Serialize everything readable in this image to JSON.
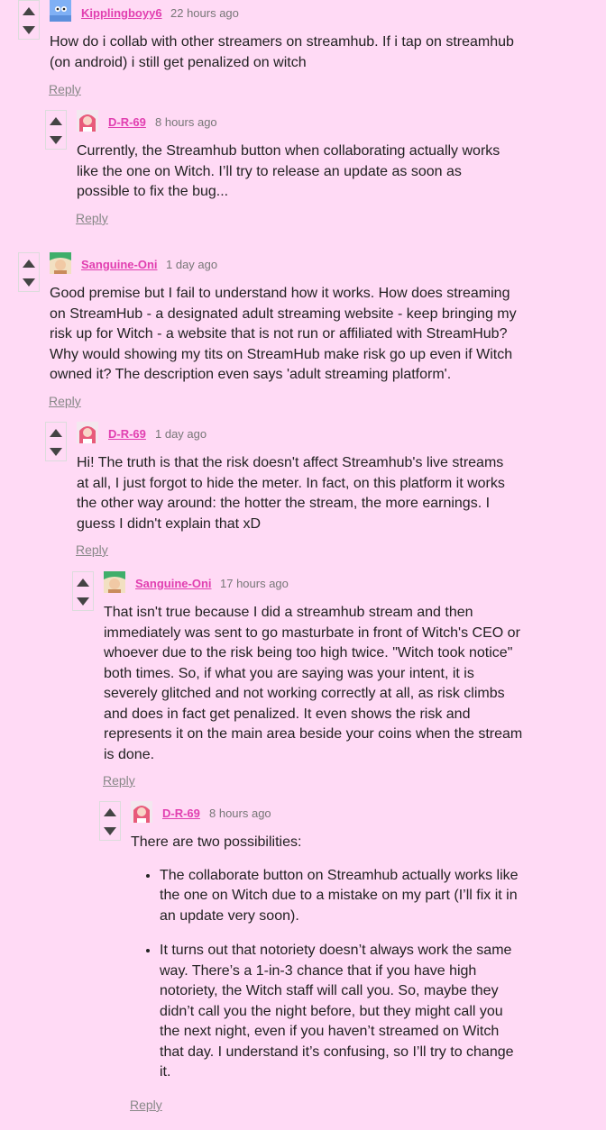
{
  "comments": [
    {
      "author": "Kipplingboyy6",
      "time": "22 hours ago",
      "body": "How do i collab with other streamers on streamhub. If i tap on streamhub (on android) i still get penalized on witch",
      "reply": "Reply"
    },
    {
      "author": "D-R-69",
      "time": "8 hours ago",
      "body": "Currently, the Streamhub button when collaborating actually works like the one on Witch. I’ll try to release an update as soon as possible to fix the bug...",
      "reply": "Reply"
    },
    {
      "author": "Sanguine-Oni",
      "time": "1 day ago",
      "body": "Good premise but I fail to understand how it works. How does streaming on StreamHub - a designated adult streaming website - keep bringing my risk up for Witch - a website that is not run or affiliated with StreamHub? Why would showing my tits on StreamHub make risk go up even if Witch owned it? The description even says 'adult streaming platform'.",
      "reply": "Reply"
    },
    {
      "author": "D-R-69",
      "time": "1 day ago",
      "body": "Hi! The truth is that the risk doesn't affect Streamhub's live streams at all, I just forgot to hide the meter. In fact, on this platform it works the other way around: the hotter the stream, the more earnings. I guess I didn't explain that xD",
      "reply": "Reply"
    },
    {
      "author": "Sanguine-Oni",
      "time": "17 hours ago",
      "body": "That isn't true because I did a streamhub stream and then immediately was sent to go masturbate in front of Witch's CEO or whoever due to the risk being too high twice. \"Witch took notice\" both times. So, if what you are saying was your intent, it is severely glitched and not working correctly at all, as risk climbs and does in fact get penalized. It even shows the risk and represents it on the main area beside your coins when the stream is done.",
      "reply": "Reply"
    },
    {
      "author": "D-R-69",
      "time": "8 hours ago",
      "body": "There are two possibilities:",
      "bullets": [
        "The collaborate button on Streamhub actually works like the one on Witch due to a mistake on my part (I’ll fix it in an update very soon).",
        "It turns out that notoriety doesn’t always work the same way. There’s a 1-in-3 chance that if you have high notoriety, the Witch staff will call you. So, maybe they didn’t call you the night before, but they might call you the next night, even if you haven’t streamed on Witch that day. I understand it’s confusing, so I’ll try to change it."
      ],
      "reply": "Reply"
    }
  ]
}
